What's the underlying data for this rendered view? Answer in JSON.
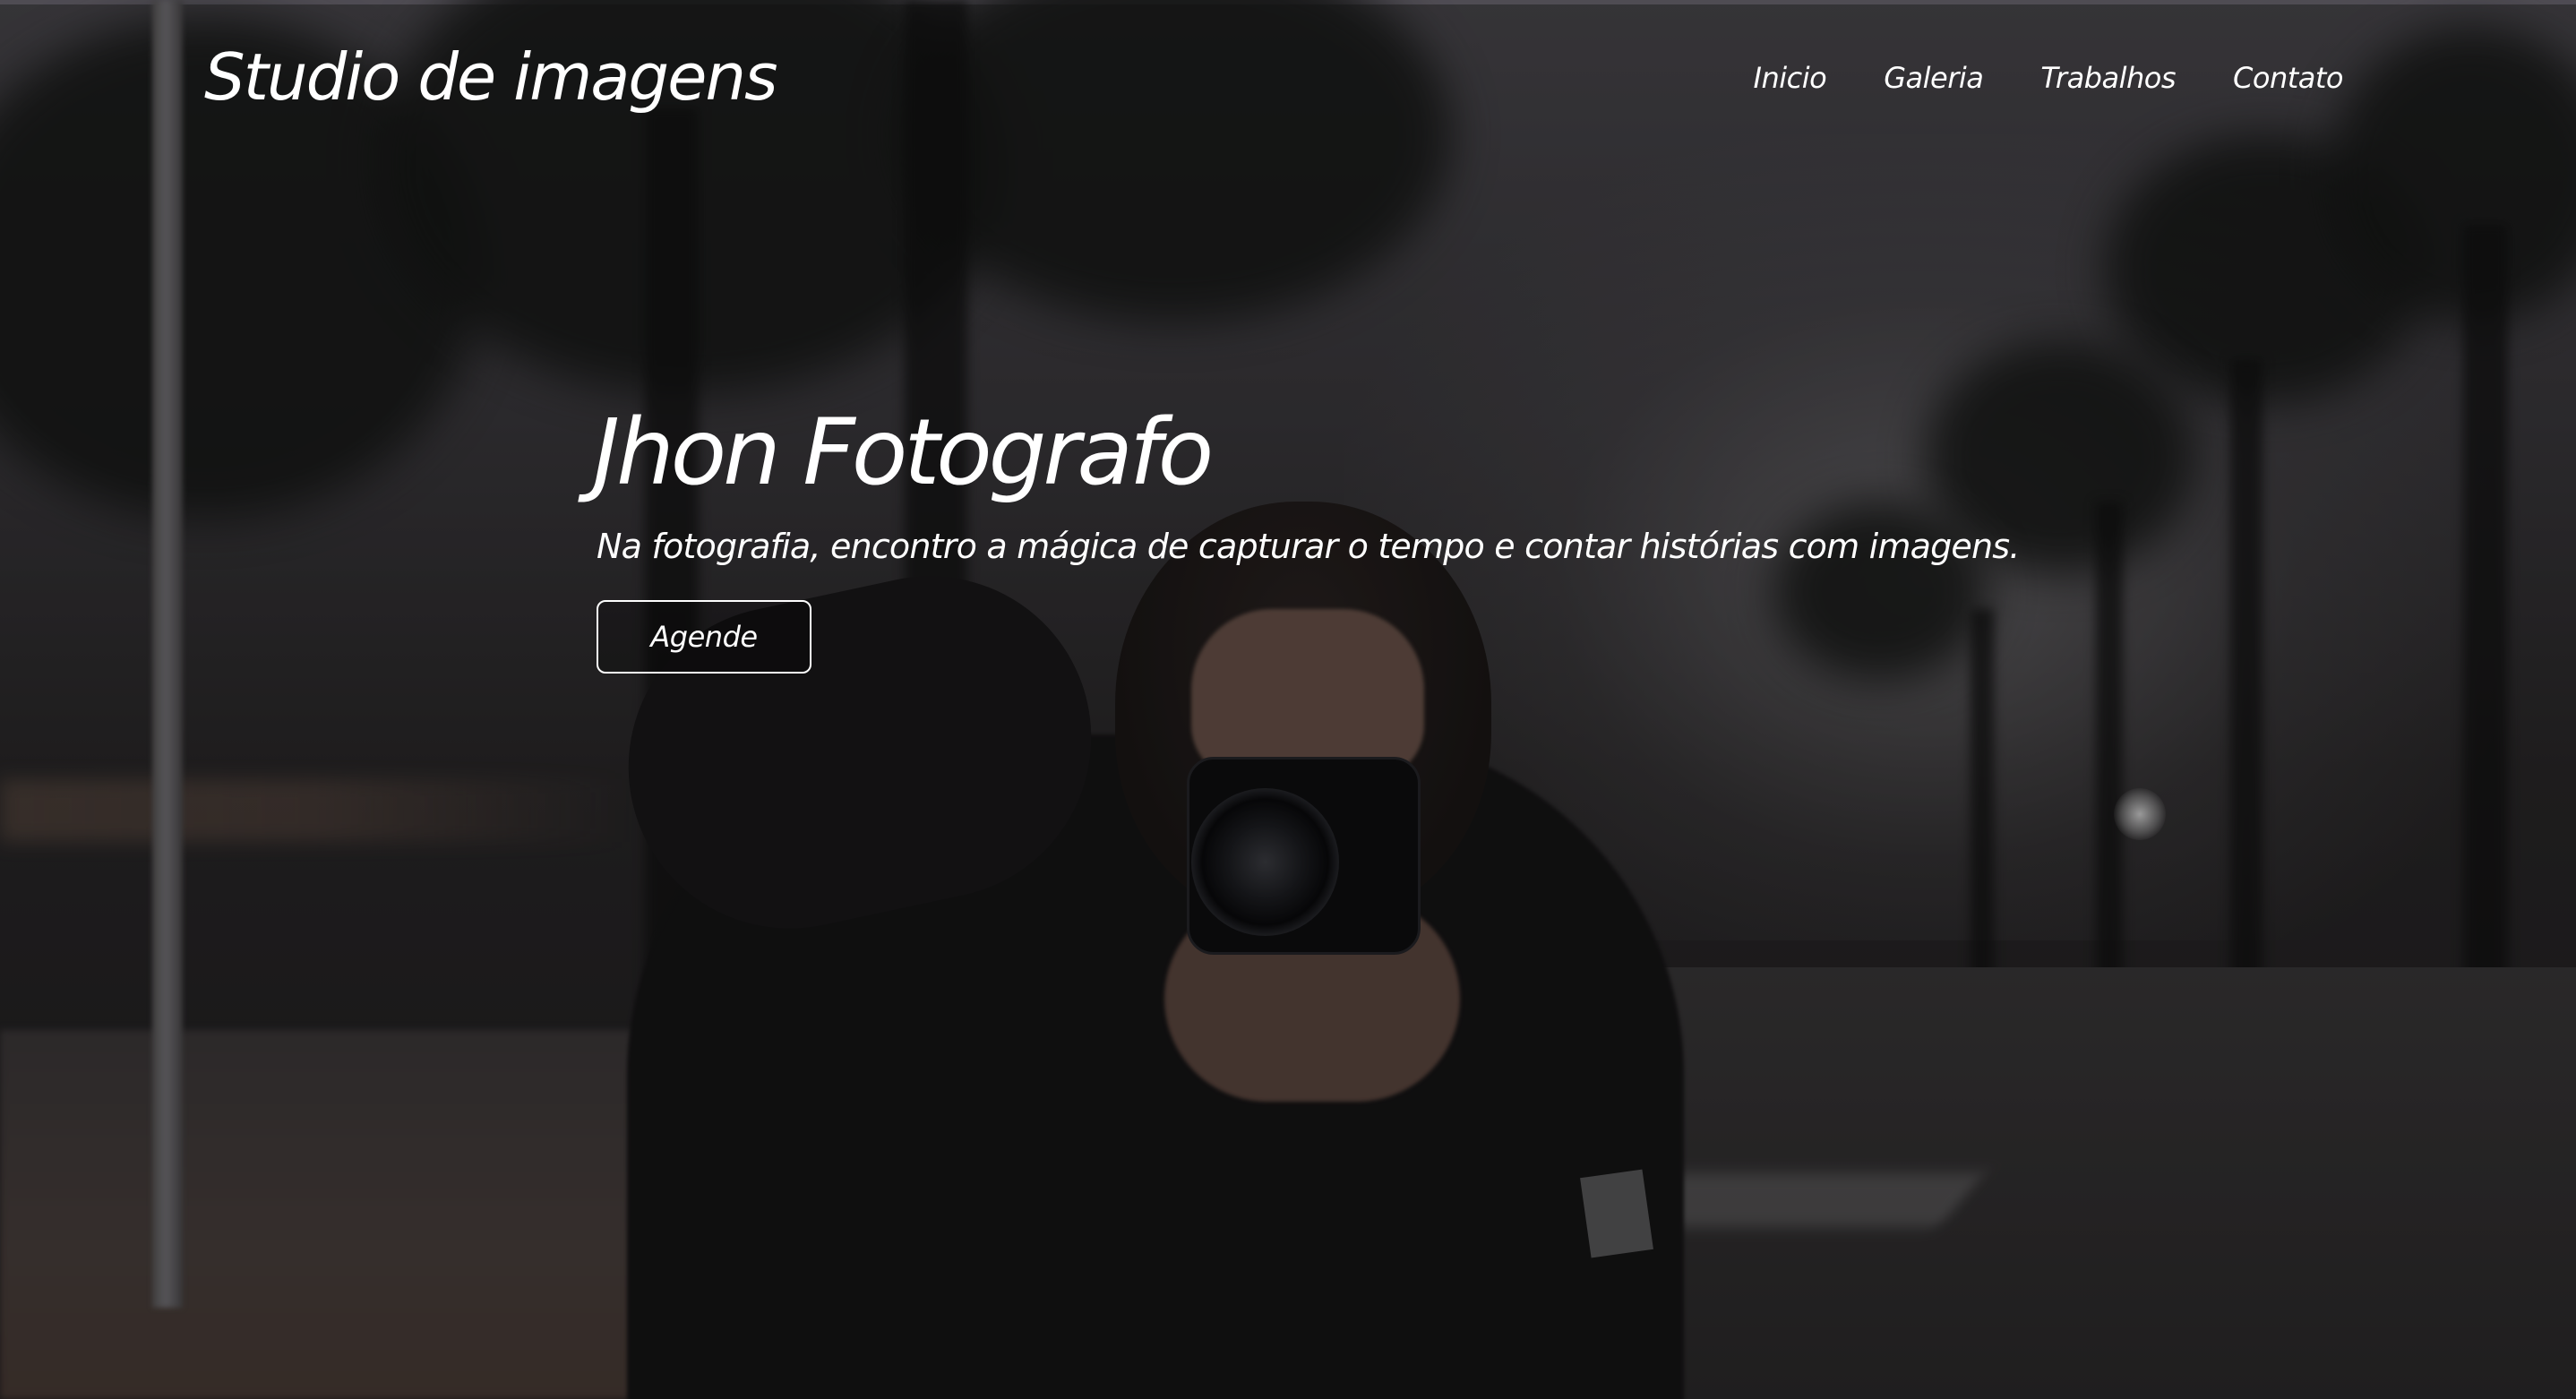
{
  "header": {
    "brand": "Studio de imagens",
    "nav": [
      {
        "label": "Inicio"
      },
      {
        "label": "Galeria"
      },
      {
        "label": "Trabalhos"
      },
      {
        "label": "Contato"
      }
    ]
  },
  "hero": {
    "title": "Jhon Fotografo",
    "subtitle": "Na fotografia, encontro a mágica de capturar o tempo e contar histórias com imagens.",
    "cta_label": "Agende",
    "background_image": "photographer-with-camera-on-street-at-dusk"
  },
  "colors": {
    "text": "#ffffff",
    "overlay": "#000000"
  }
}
